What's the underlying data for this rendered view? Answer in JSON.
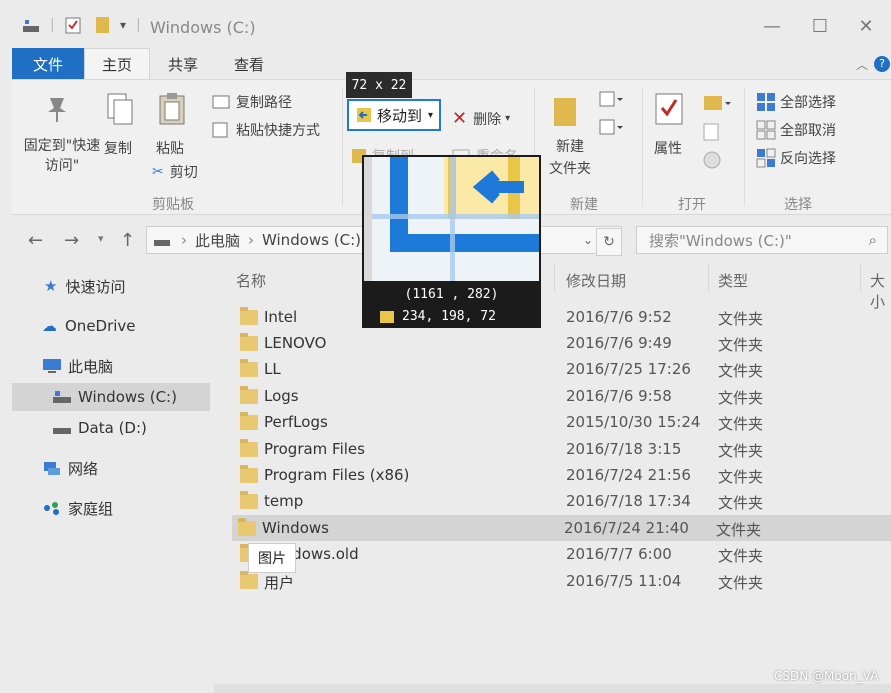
{
  "window": {
    "title": "Windows (C:)"
  },
  "tabs": [
    {
      "label": "文件"
    },
    {
      "label": "主页"
    },
    {
      "label": "共享"
    },
    {
      "label": "查看"
    }
  ],
  "ribbon": {
    "pin_label": "固定到\"快速访问\"",
    "copy_label": "复制",
    "paste_label": "粘贴",
    "copy_path": "复制路径",
    "paste_shortcut": "粘贴快捷方式",
    "cut": "剪切",
    "clipboard_group": "剪贴板",
    "move_to": "移动到",
    "delete": "删除",
    "copy_to": "复制到",
    "rename": "重命名",
    "new_folder": "新建\n文件夹",
    "new_group": "新建",
    "properties": "属性",
    "open_group": "打开",
    "select_all": "全部选择",
    "select_none": "全部取消",
    "invert_select": "反向选择",
    "select_group": "选择"
  },
  "address": {
    "crumb1": "此电脑",
    "crumb2": "Windows (C:)",
    "search_placeholder": "搜索\"Windows (C:)\""
  },
  "nav": [
    {
      "label": "快速访问"
    },
    {
      "label": "OneDrive"
    },
    {
      "label": "此电脑"
    },
    {
      "label": "Windows (C:)"
    },
    {
      "label": "Data (D:)"
    },
    {
      "label": "网络"
    },
    {
      "label": "家庭组"
    }
  ],
  "columns": {
    "name": "名称",
    "date": "修改日期",
    "type": "类型",
    "size": "大小"
  },
  "files": [
    {
      "name": "Intel",
      "date": "2016/7/6 9:52",
      "type": "文件夹"
    },
    {
      "name": "LENOVO",
      "date": "2016/7/6 9:49",
      "type": "文件夹"
    },
    {
      "name": "LL",
      "date": "2016/7/25 17:26",
      "type": "文件夹"
    },
    {
      "name": "Logs",
      "date": "2016/7/6 9:58",
      "type": "文件夹"
    },
    {
      "name": "PerfLogs",
      "date": "2015/10/30 15:24",
      "type": "文件夹"
    },
    {
      "name": "Program Files",
      "date": "2016/7/18 3:15",
      "type": "文件夹"
    },
    {
      "name": "Program Files (x86)",
      "date": "2016/7/24 21:56",
      "type": "文件夹"
    },
    {
      "name": "temp",
      "date": "2016/7/18 17:34",
      "type": "文件夹"
    },
    {
      "name": "Windows",
      "date": "2016/7/24 21:40",
      "type": "文件夹"
    },
    {
      "name": "Windows.old",
      "date": "2016/7/7 6:00",
      "type": "文件夹"
    },
    {
      "name": "用户",
      "date": "2016/7/5 11:04",
      "type": "文件夹"
    }
  ],
  "capture": {
    "size": "72 x 22",
    "coord": "(1161 , 282)",
    "rgb": "234, 198,  72",
    "swatch_color": "#eac648"
  },
  "tooltip": "图片",
  "watermark": "CSDN @Moon_VA"
}
